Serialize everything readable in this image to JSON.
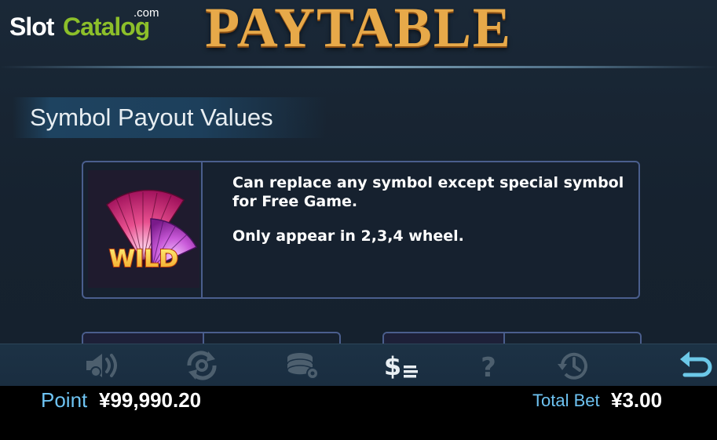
{
  "brand": {
    "part1": "Slot",
    "part2": "Catalog",
    "suffix": ".com"
  },
  "header": {
    "title": "PAYTABLE"
  },
  "section": {
    "title": "Symbol Payout Values"
  },
  "wild_card": {
    "symbol_label": "WILD",
    "description_1": "Can replace any symbol except special symbol for Free Game.",
    "description_2": "Only appear in 2,3,4 wheel."
  },
  "toolbar": {
    "icons": [
      "sound-icon",
      "autoplay-icon",
      "chips-settings-icon",
      "paytable-icon",
      "help-icon",
      "history-icon",
      "back-icon"
    ],
    "active": "paytable-icon",
    "accent": "#6cc8e8",
    "inactive": "#4d5f6e"
  },
  "status": {
    "point_label": "Point",
    "point_value": "¥99,990.20",
    "bet_label": "Total Bet",
    "bet_value": "¥3.00"
  }
}
